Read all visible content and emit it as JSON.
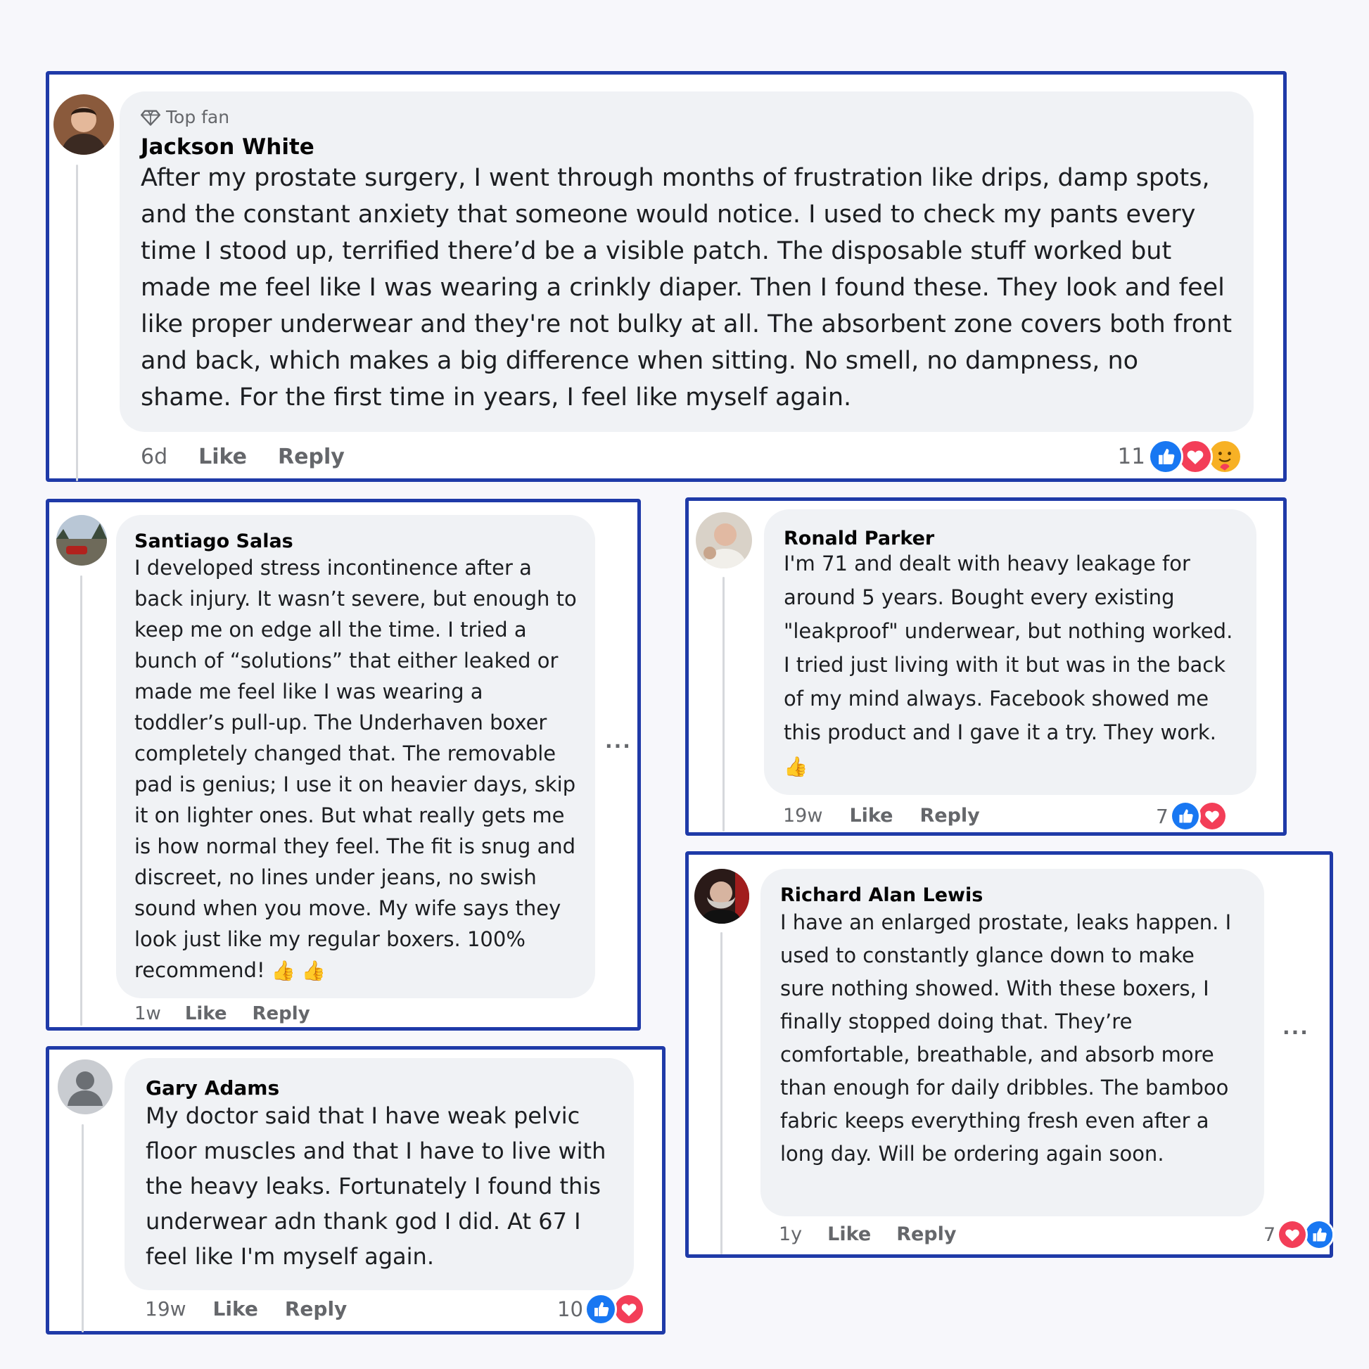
{
  "colors": {
    "card_border": "#1f3aa8",
    "bubble_bg": "#f0f2f5",
    "meta_text": "#65676b",
    "like_blue": "#1877f2",
    "love_red": "#f33e58",
    "care_yellow": "#f7b125"
  },
  "comments": [
    {
      "id": "jackson",
      "badge_icon": "diamond-icon",
      "badge": "Top fan",
      "name": "Jackson White",
      "text": "After my prostate surgery, I went through months of frustration like drips, damp spots, and the constant anxiety that someone would notice. I used to check my pants every time I stood up, terrified there’d be a visible patch. The disposable stuff worked but made me feel like I was wearing a crinkly diaper. Then I found these. They look and feel like proper underwear and they're not bulky at all. The absorbent zone covers both front and back, which makes a big difference when sitting. No smell, no dampness, no shame. For the first time in years, I feel like myself again.",
      "time": "6d",
      "like_label": "Like",
      "reply_label": "Reply",
      "reaction_count": "11",
      "reactions": [
        "like-icon",
        "love-icon",
        "care-icon"
      ]
    },
    {
      "id": "santiago",
      "name": "Santiago Salas",
      "text": "I developed stress incontinence after a back injury. It wasn’t severe, but enough to keep me on edge all the time. I tried a bunch of “solutions” that either leaked or made me feel like I was wearing a toddler’s pull-up. The Underhaven boxer completely changed that. The removable pad is genius; I use it on heavier days, skip it on lighter ones. But what really gets me is how normal they feel. The fit is snug and discreet, no lines under jeans, no swish sound when you move. My wife says they look just like my regular boxers. 100% recommend!",
      "emoji": "👍 👍",
      "time": "1w",
      "like_label": "Like",
      "reply_label": "Reply",
      "more_label": "···"
    },
    {
      "id": "ronald",
      "name": "Ronald Parker",
      "text": "I'm 71 and dealt with heavy leakage for around 5 years. Bought every existing \"leakproof\" underwear, but nothing worked. I tried just living with it but was in the back of my mind always. Facebook showed me this product and I gave it a try. They work.",
      "emoji": "👍",
      "time": "19w",
      "like_label": "Like",
      "reply_label": "Reply",
      "reaction_count": "7",
      "reactions": [
        "like-icon",
        "love-icon"
      ]
    },
    {
      "id": "richard",
      "name": "Richard Alan Lewis",
      "text": "I have an enlarged prostate, leaks happen. I used to constantly glance down to make sure nothing showed. With these boxers, I finally stopped doing that. They’re comfortable, breathable, and absorb more than enough for daily dribbles. The bamboo fabric keeps everything fresh even after a long day. Will be ordering again soon.",
      "time": "1y",
      "like_label": "Like",
      "reply_label": "Reply",
      "more_label": "···",
      "reaction_count": "7",
      "reactions": [
        "love-icon",
        "like-icon"
      ]
    },
    {
      "id": "gary",
      "name": "Gary Adams",
      "text": "My doctor said that I have weak pelvic floor muscles and that I have to live with the heavy leaks. Fortunately I found this underwear adn thank god I did. At 67 I feel like I'm myself again.",
      "time": "19w",
      "like_label": "Like",
      "reply_label": "Reply",
      "reaction_count": "10",
      "reactions": [
        "like-icon",
        "love-icon"
      ]
    }
  ]
}
